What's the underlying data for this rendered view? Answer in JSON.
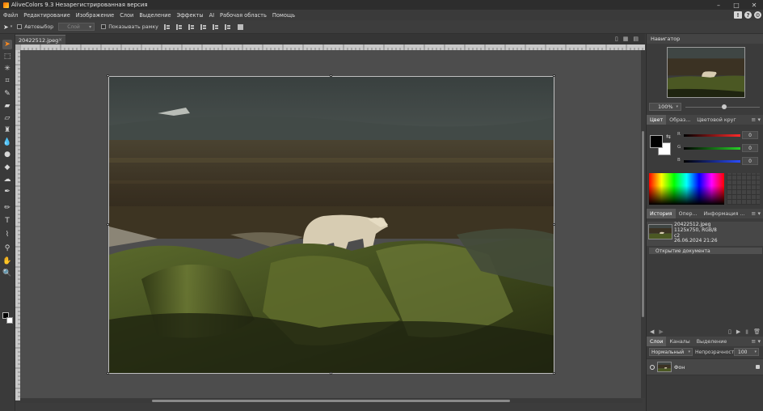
{
  "window": {
    "title": "AliveColors 9.3 Незарегистрированная версия",
    "controls": [
      "–",
      "□",
      "✕"
    ]
  },
  "menu": {
    "items": [
      "Файл",
      "Редактирование",
      "Изображение",
      "Слои",
      "Выделение",
      "Эффекты",
      "AI",
      "Рабочая область",
      "Помощь"
    ]
  },
  "options": {
    "autoselect_label": "Автовыбор",
    "layer_select_value": "Слой",
    "show_frame_label": "Показывать рамку"
  },
  "document": {
    "tab_name": "20422512.jpeg",
    "tab_close": "×"
  },
  "navigator": {
    "title": "Навигатор",
    "zoom": "100%"
  },
  "color_panel": {
    "tabs": [
      "Цвет",
      "Образ...",
      "Цветовой круг"
    ],
    "channels": [
      {
        "label": "R",
        "value": "0",
        "color": "#e23b3b"
      },
      {
        "label": "G",
        "value": "0",
        "color": "#3fbf3f"
      },
      {
        "label": "B",
        "value": "0",
        "color": "#3f5fe0"
      }
    ]
  },
  "history_panel": {
    "tabs": [
      "История",
      "Опер...",
      "Информация ..."
    ],
    "item_name": "20422512.jpeg",
    "item_dims": "1125x750, RGB/8",
    "item_extra": "c2",
    "item_date": "26.06.2024 21:26",
    "step": "Открытие документа"
  },
  "layers_panel": {
    "tabs": [
      "Слои",
      "Каналы",
      "Выделение"
    ],
    "blend_mode": "Нормальный",
    "opacity_label": "Непрозрачность",
    "opacity_value": "100",
    "layer_name": "Фон"
  },
  "colors": {
    "accent": "#ff8a1e",
    "panel_bg": "#3b3b3b",
    "canvas_bg": "#4d4d4d"
  }
}
